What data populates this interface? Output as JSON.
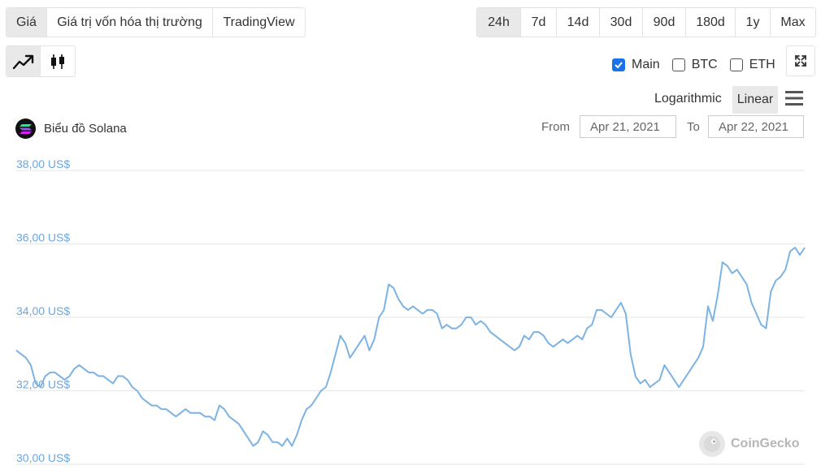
{
  "tabs_main": [
    "Giá",
    "Giá trị vốn hóa thị trường",
    "TradingView"
  ],
  "tabs_main_active": 0,
  "tabs_range": [
    "24h",
    "7d",
    "14d",
    "30d",
    "90d",
    "180d",
    "1y",
    "Max"
  ],
  "tabs_range_active": 0,
  "chart_type_icons": [
    "line-chart-icon",
    "candlestick-icon"
  ],
  "chart_type_active": 0,
  "compare": {
    "main": {
      "label": "Main",
      "checked": true
    },
    "btc": {
      "label": "BTC",
      "checked": false
    },
    "eth": {
      "label": "ETH",
      "checked": false
    }
  },
  "scale": {
    "logarithmic": "Logarithmic",
    "linear": "Linear",
    "active": "linear"
  },
  "chart_title": "Biểu đồ Solana",
  "date_range": {
    "from_label": "From",
    "from_value": "Apr 21, 2021",
    "to_label": "To",
    "to_value": "Apr 22, 2021"
  },
  "watermark": "CoinGecko",
  "colors": {
    "line": "#7db3e3",
    "axis_label": "#6ca6de",
    "grid": "#e6e6e6"
  },
  "chart_data": {
    "type": "line",
    "title": "Biểu đồ Solana",
    "xlabel": "",
    "ylabel": "",
    "ylim": [
      30,
      38
    ],
    "y_ticks": [
      "38,00 US$",
      "36,00 US$",
      "34,00 US$",
      "32,00 US$",
      "30,00 US$"
    ],
    "y_tick_values": [
      38,
      36,
      34,
      32,
      30
    ],
    "grid": true,
    "series": [
      {
        "values": [
          33.1,
          33.0,
          32.9,
          32.7,
          32.2,
          32.1,
          32.4,
          32.5,
          32.5,
          32.4,
          32.3,
          32.4,
          32.6,
          32.7,
          32.6,
          32.5,
          32.5,
          32.4,
          32.4,
          32.3,
          32.2,
          32.4,
          32.4,
          32.3,
          32.1,
          32.0,
          31.8,
          31.7,
          31.6,
          31.6,
          31.5,
          31.5,
          31.4,
          31.3,
          31.4,
          31.5,
          31.4,
          31.4,
          31.4,
          31.3,
          31.3,
          31.2,
          31.6,
          31.5,
          31.3,
          31.2,
          31.1,
          30.9,
          30.7,
          30.5,
          30.6,
          30.9,
          30.8,
          30.6,
          30.6,
          30.5,
          30.7,
          30.5,
          30.8,
          31.2,
          31.5,
          31.6,
          31.8,
          32.0,
          32.1,
          32.5,
          33.0,
          33.5,
          33.3,
          32.9,
          33.1,
          33.3,
          33.5,
          33.1,
          33.4,
          34.0,
          34.2,
          34.9,
          34.8,
          34.5,
          34.3,
          34.2,
          34.3,
          34.2,
          34.1,
          34.2,
          34.2,
          34.1,
          33.7,
          33.8,
          33.7,
          33.7,
          33.8,
          34.0,
          34.0,
          33.8,
          33.9,
          33.8,
          33.6,
          33.5,
          33.4,
          33.3,
          33.2,
          33.1,
          33.2,
          33.5,
          33.4,
          33.6,
          33.6,
          33.5,
          33.3,
          33.2,
          33.3,
          33.4,
          33.3,
          33.4,
          33.5,
          33.4,
          33.7,
          33.8,
          34.2,
          34.2,
          34.1,
          34.0,
          34.2,
          34.4,
          34.1,
          33.0,
          32.4,
          32.2,
          32.3,
          32.1,
          32.2,
          32.3,
          32.7,
          32.5,
          32.3,
          32.1,
          32.3,
          32.5,
          32.7,
          32.9,
          33.2,
          34.3,
          33.9,
          34.6,
          35.5,
          35.4,
          35.2,
          35.3,
          35.1,
          34.9,
          34.4,
          34.1,
          33.8,
          33.7,
          34.7,
          35.0,
          35.1,
          35.3,
          35.8,
          35.9,
          35.7,
          35.9
        ]
      }
    ]
  }
}
